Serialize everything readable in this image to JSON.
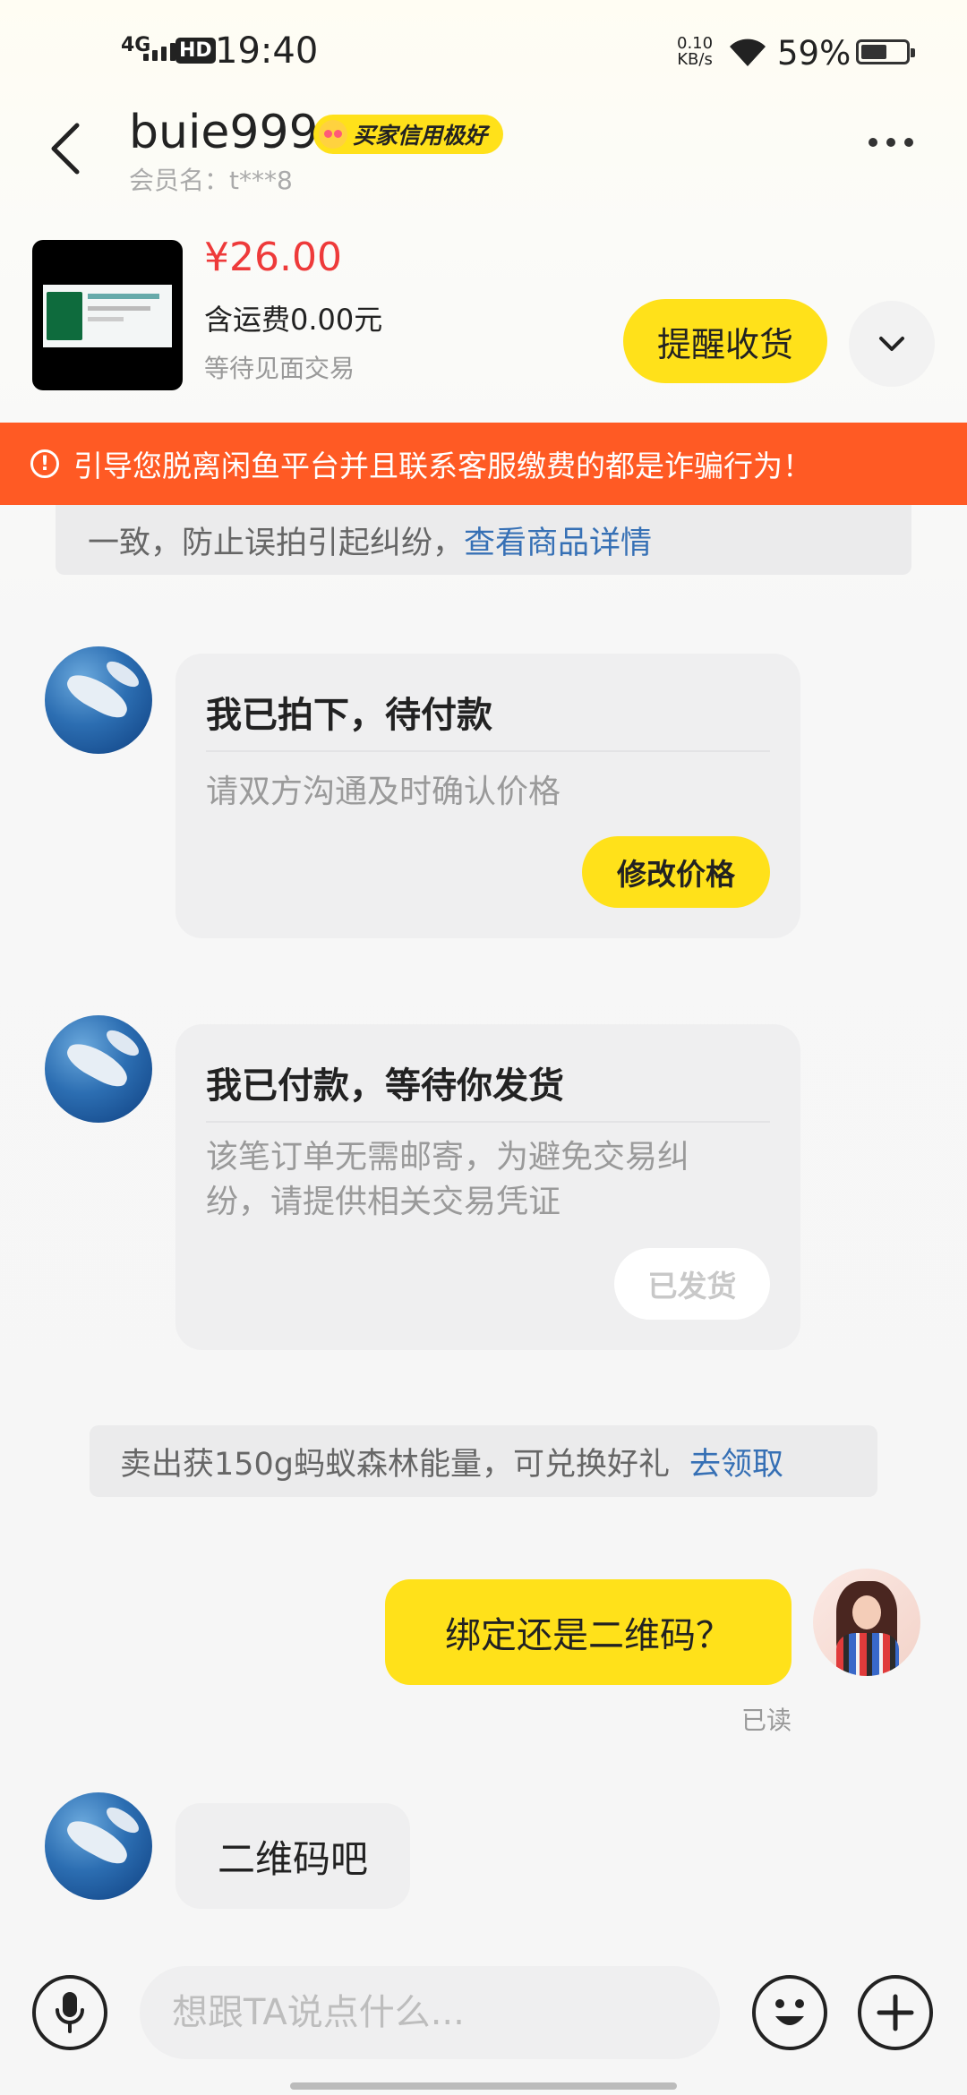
{
  "status_bar": {
    "network": "4G",
    "hd": "HD",
    "time": "19:40",
    "speed_value": "0.10",
    "speed_unit": "KB/s",
    "battery_pct": "59%",
    "battery_level": 0.59
  },
  "header": {
    "seller_name": "buie999",
    "credit_badge": "买家信用极好",
    "member_label": "会员名：t***8"
  },
  "product": {
    "price": "¥26.00",
    "shipping": "含运费0.00元",
    "status": "等待见面交易",
    "remind_button": "提醒收货"
  },
  "warning": {
    "text": "引导您脱离闲鱼平台并且联系客服缴费的都是诈骗行为！"
  },
  "notice_top": {
    "text": "一致，防止误拍引起纠纷，",
    "link": "查看商品详情"
  },
  "cards": [
    {
      "title": "我已拍下，待付款",
      "desc": "请双方沟通及时确认价格",
      "button": "修改价格"
    },
    {
      "title": "我已付款，等待你发货",
      "desc": "该笔订单无需邮寄，为避免交易纠纷，请提供相关交易凭证",
      "button": "已发货"
    }
  ],
  "notice_bottom": {
    "text": "卖出获150g蚂蚁森林能量，可兑换好礼",
    "link": "去领取"
  },
  "messages": {
    "mine": "绑定还是二维码？",
    "read_status": "已读",
    "theirs": "二维码吧"
  },
  "input": {
    "placeholder": "想跟TA说点什么..."
  },
  "colors": {
    "accent_yellow": "#ffe11a",
    "warning_orange": "#ff5a24",
    "price_red": "#ee3a3a",
    "link_blue": "#3670b5"
  },
  "icons": [
    "back-icon",
    "more-icon",
    "chevron-down-icon",
    "warning-icon",
    "mic-icon",
    "emoji-icon",
    "plus-icon",
    "wifi-icon",
    "battery-icon"
  ]
}
